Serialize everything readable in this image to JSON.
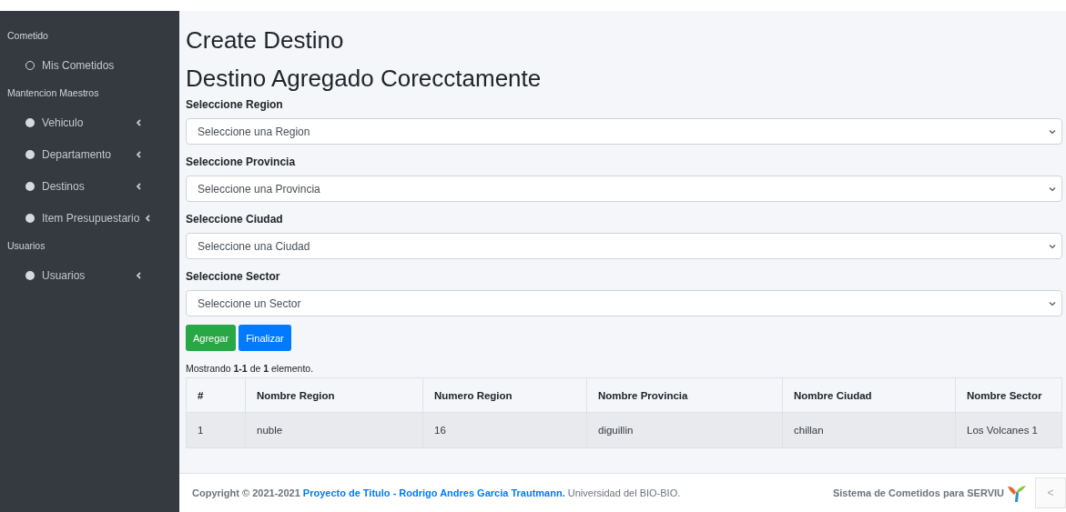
{
  "sidebar": {
    "items": [
      {
        "kind": "header",
        "label": "Cometido"
      },
      {
        "kind": "item",
        "label": "Mis Cometidos"
      },
      {
        "kind": "header",
        "label": "Mantencion Maestros"
      },
      {
        "kind": "tree",
        "label": "Vehiculo"
      },
      {
        "kind": "tree",
        "label": "Departamento"
      },
      {
        "kind": "tree",
        "label": "Destinos"
      },
      {
        "kind": "tree",
        "label": "Item Presupuestario"
      },
      {
        "kind": "header",
        "label": "Usuarios"
      },
      {
        "kind": "tree",
        "label": "Usuarios"
      }
    ]
  },
  "page": {
    "title": "Create Destino",
    "message": "Destino Agregado Corecctamente"
  },
  "form": {
    "fields": [
      {
        "label": "Seleccione Region",
        "placeholder": "Seleccione una Region"
      },
      {
        "label": "Seleccione Provincia",
        "placeholder": "Seleccione una Provincia"
      },
      {
        "label": "Seleccione Ciudad",
        "placeholder": "Seleccione una Ciudad"
      },
      {
        "label": "Seleccione Sector",
        "placeholder": "Seleccione un Sector"
      }
    ],
    "buttons": [
      {
        "label": "Agregar",
        "kind": "success"
      },
      {
        "label": "Finalizar",
        "kind": "primary"
      }
    ]
  },
  "table": {
    "summary": "Mostrando **1-1** de **1** elemento.",
    "columns": [
      "#",
      "Nombre Region",
      "Numero Region",
      "Nombre Provincia",
      "Nombre Ciudad",
      "Nombre Sector"
    ],
    "rows": [
      [
        "1",
        "nuble",
        "16",
        "diguillin",
        "chillan",
        "Los Volcanes 1"
      ]
    ]
  },
  "footer": {
    "copyright": "Copyright © 2021-2021 ",
    "link": "Proyecto de Titulo - Rodrigo Andres Garcia Trautmann.",
    "institution": " Universidad del BIO-BIO.",
    "system": "Sistema de Cometidos para SERVIU",
    "back_button": "<"
  }
}
